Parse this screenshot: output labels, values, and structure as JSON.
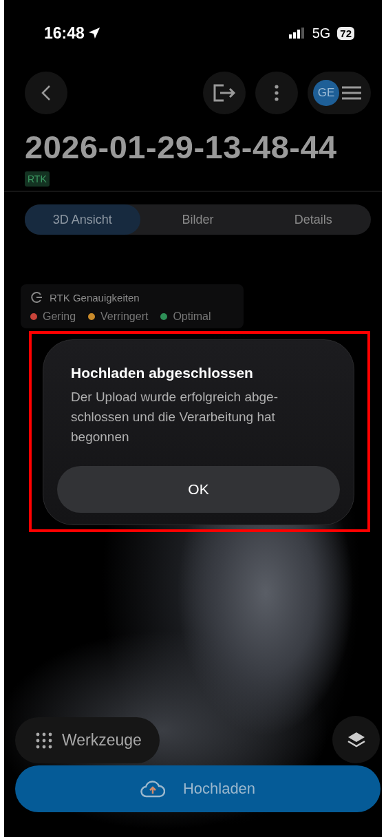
{
  "status_bar": {
    "time": "16:48",
    "network": "5G",
    "battery": "72"
  },
  "header": {
    "avatar_initials": "GE"
  },
  "title": "2026-01-29-13-48-44",
  "badge": "RTK",
  "tabs": [
    {
      "label": "3D Ansicht",
      "selected": true
    },
    {
      "label": "Bilder",
      "selected": false
    },
    {
      "label": "Details",
      "selected": false
    }
  ],
  "legend": {
    "title": "RTK Genauigkeiten",
    "items": [
      {
        "label": "Gering",
        "color": "#c8443a"
      },
      {
        "label": "Verringert",
        "color": "#c98a2a"
      },
      {
        "label": "Optimal",
        "color": "#2e8f57"
      }
    ]
  },
  "dialog": {
    "title": "Hochladen abgeschlossen",
    "message": "Der Upload wurde erfolgreich abge-schlossen und die Verarbeitung hat begonnen",
    "button": "OK"
  },
  "tools_button": "Werkzeuge",
  "upload_button": "Hochladen"
}
